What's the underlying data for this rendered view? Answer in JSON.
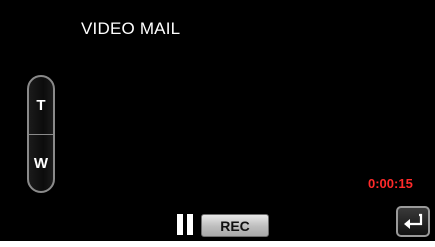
{
  "screen": {
    "title": "VIDEO MAIL",
    "zoom": {
      "tele_label": "T",
      "wide_label": "W"
    },
    "timecode": "0:00:15",
    "controls": {
      "pause_icon": "pause-icon",
      "rec_label": "REC",
      "back_icon": "return-arrow-icon"
    },
    "colors": {
      "background": "#000000",
      "timecode": "#ff2a2a",
      "text": "#ffffff"
    }
  }
}
